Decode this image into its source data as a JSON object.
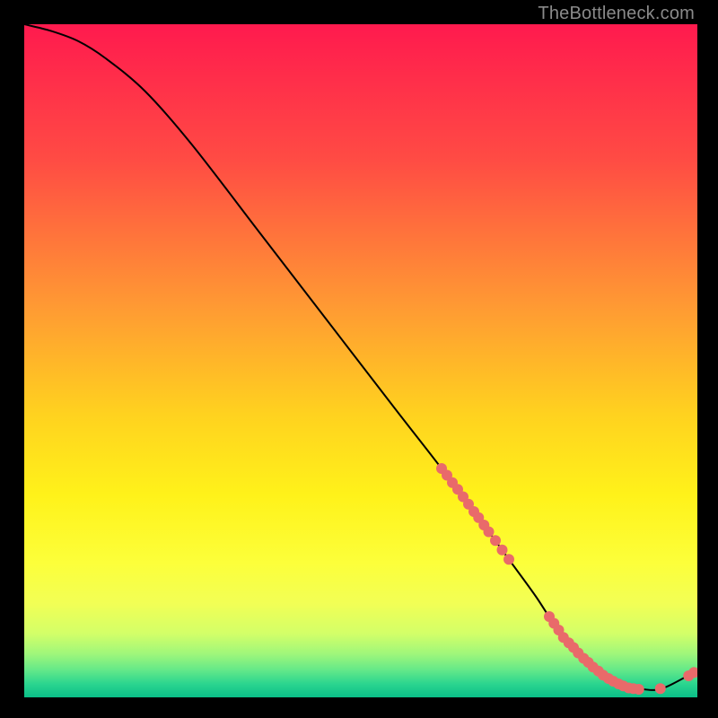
{
  "watermark": {
    "text": "TheBottleneck.com"
  },
  "chart_data": {
    "type": "line",
    "title": "",
    "xlabel": "",
    "ylabel": "",
    "xlim": [
      0,
      100
    ],
    "ylim": [
      0,
      100
    ],
    "grid": false,
    "curve": {
      "name": "bottleneck-curve",
      "x": [
        0,
        4,
        8,
        12,
        18,
        25,
        35,
        45,
        55,
        62,
        68,
        72,
        76,
        80,
        84,
        88,
        92,
        95,
        100
      ],
      "y": [
        100,
        99,
        97.5,
        95,
        90,
        82,
        69,
        56,
        43,
        34,
        26,
        20.5,
        15,
        9,
        5,
        2.2,
        1.2,
        1.4,
        4
      ]
    },
    "markers": {
      "name": "highlight-points",
      "color": "#e96a6a",
      "radius": 6,
      "points": [
        {
          "x": 62.0,
          "y": 34.0
        },
        {
          "x": 62.8,
          "y": 33.0
        },
        {
          "x": 63.6,
          "y": 31.9
        },
        {
          "x": 64.4,
          "y": 30.9
        },
        {
          "x": 65.2,
          "y": 29.8
        },
        {
          "x": 66.0,
          "y": 28.7
        },
        {
          "x": 66.8,
          "y": 27.6
        },
        {
          "x": 67.5,
          "y": 26.7
        },
        {
          "x": 68.3,
          "y": 25.6
        },
        {
          "x": 69.0,
          "y": 24.6
        },
        {
          "x": 70.0,
          "y": 23.3
        },
        {
          "x": 71.0,
          "y": 21.9
        },
        {
          "x": 72.0,
          "y": 20.5
        },
        {
          "x": 78.0,
          "y": 12.0
        },
        {
          "x": 78.7,
          "y": 11.0
        },
        {
          "x": 79.4,
          "y": 10.0
        },
        {
          "x": 80.1,
          "y": 8.9
        },
        {
          "x": 80.9,
          "y": 8.1
        },
        {
          "x": 81.6,
          "y": 7.4
        },
        {
          "x": 82.3,
          "y": 6.6
        },
        {
          "x": 83.1,
          "y": 5.8
        },
        {
          "x": 83.8,
          "y": 5.2
        },
        {
          "x": 84.5,
          "y": 4.5
        },
        {
          "x": 85.3,
          "y": 3.9
        },
        {
          "x": 86.0,
          "y": 3.3
        },
        {
          "x": 86.8,
          "y": 2.8
        },
        {
          "x": 87.5,
          "y": 2.4
        },
        {
          "x": 88.3,
          "y": 2.0
        },
        {
          "x": 89.0,
          "y": 1.7
        },
        {
          "x": 89.8,
          "y": 1.4
        },
        {
          "x": 90.5,
          "y": 1.3
        },
        {
          "x": 91.3,
          "y": 1.2
        },
        {
          "x": 94.5,
          "y": 1.3
        },
        {
          "x": 98.7,
          "y": 3.2
        },
        {
          "x": 99.5,
          "y": 3.7
        }
      ]
    },
    "gradient_stops": [
      {
        "offset": 0.0,
        "color": "#ff1a4e"
      },
      {
        "offset": 0.2,
        "color": "#ff4b44"
      },
      {
        "offset": 0.42,
        "color": "#ff9a33"
      },
      {
        "offset": 0.58,
        "color": "#ffd21f"
      },
      {
        "offset": 0.7,
        "color": "#fff21a"
      },
      {
        "offset": 0.8,
        "color": "#fcff3a"
      },
      {
        "offset": 0.86,
        "color": "#f2ff55"
      },
      {
        "offset": 0.905,
        "color": "#d3ff68"
      },
      {
        "offset": 0.935,
        "color": "#a0f77a"
      },
      {
        "offset": 0.96,
        "color": "#62e889"
      },
      {
        "offset": 0.98,
        "color": "#2bd58f"
      },
      {
        "offset": 1.0,
        "color": "#0abf88"
      }
    ]
  }
}
